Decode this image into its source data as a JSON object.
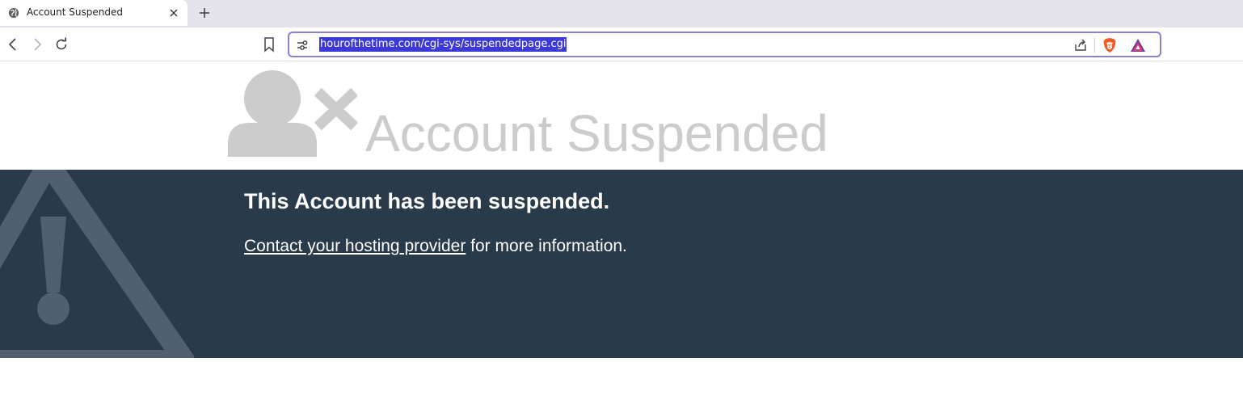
{
  "browser": {
    "tab": {
      "title": "Account Suspended"
    },
    "address_bar": {
      "url": "hourofthetime.com/cgi-sys/suspendedpage.cgi"
    }
  },
  "page": {
    "hero_title": "Account Suspended",
    "heading": "This Account has been suspended.",
    "link_text": "Contact your hosting provider",
    "link_suffix": " for more information."
  },
  "colors": {
    "banner_bg": "#293a4a",
    "hero_gray": "#cccccc",
    "url_highlight": "#3b3ad6",
    "omnibox_border": "#8b7fd6"
  },
  "icons": [
    "globe-icon",
    "close-icon",
    "plus-icon",
    "back-arrow-icon",
    "forward-arrow-icon",
    "reload-icon",
    "bookmark-icon",
    "site-settings-icon",
    "share-icon",
    "brave-shields-icon",
    "brave-rewards-icon",
    "user-x-icon",
    "warning-triangle-icon"
  ]
}
